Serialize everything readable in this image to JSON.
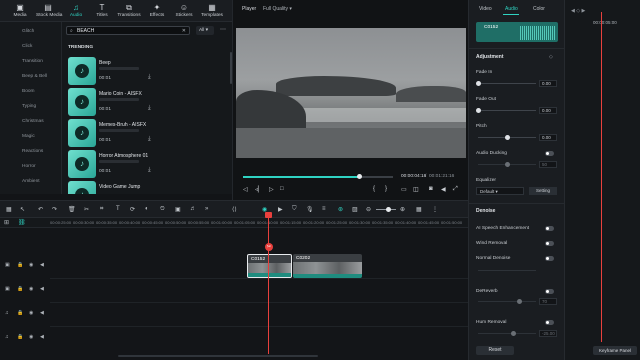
{
  "toolbar": {
    "items": [
      {
        "label": "Media",
        "icon": "media-icon"
      },
      {
        "label": "Stock Media",
        "icon": "stock-media-icon"
      },
      {
        "label": "Audio",
        "icon": "audio-icon"
      },
      {
        "label": "Titles",
        "icon": "titles-icon"
      },
      {
        "label": "Transitions",
        "icon": "transitions-icon"
      },
      {
        "label": "Effects",
        "icon": "effects-icon"
      },
      {
        "label": "Stickers",
        "icon": "stickers-icon"
      },
      {
        "label": "Templates",
        "icon": "templates-icon"
      }
    ],
    "active": "Audio"
  },
  "categories": [
    "Glitch",
    "Click",
    "Transition",
    "Beep & Bell",
    "Boom",
    "Typing",
    "Christmas",
    "Magic",
    "Reactions",
    "Horror",
    "Ambient"
  ],
  "search": {
    "value": "BEACH",
    "filter": "All"
  },
  "library": {
    "section": "TRENDING",
    "sounds": [
      {
        "title": "Beep",
        "duration": "00:01"
      },
      {
        "title": "Mario Coin - AISFX",
        "duration": "00:01"
      },
      {
        "title": "Memes-Bruh - AISFX",
        "duration": "00:01"
      },
      {
        "title": "Horror Atmosphere 01",
        "duration": "00:01"
      },
      {
        "title": "Video Game Jump",
        "duration": ""
      }
    ]
  },
  "player": {
    "label": "Player",
    "quality": "Full Quality",
    "current_time": "00:00:04:18",
    "separator": "/",
    "total_time": "00:01:21:16",
    "progress": 0.77
  },
  "properties": {
    "tabs": [
      "Video",
      "Audio",
      "Color"
    ],
    "active_tab": "Audio",
    "clip_name": "C0152",
    "adjustment": {
      "title": "Adjustment",
      "fade_in_label": "Fade In",
      "fade_in_value": "0.00",
      "fade_out_label": "Fade Out",
      "fade_out_value": "0.00",
      "pitch_label": "Pitch",
      "pitch_value": "0.00",
      "ducking_label": "Audio Ducking",
      "ducking_value": "50",
      "equalizer_label": "Equalizer",
      "equalizer_value": "Default",
      "equalizer_setting": "Setting"
    },
    "denoise": {
      "title": "Denoise",
      "ai_speech": "AI Speech Enhancement",
      "wind": "Wind Removal",
      "normal": "Normal Denoise",
      "dereverb": "DeReverb",
      "dereverb_value": "70",
      "hum": "Hum Removal",
      "hum_value": "-25.00"
    },
    "reset_label": "Reset"
  },
  "keyframe": {
    "time": "00:00:05:00",
    "button_label": "Keyframe Panel"
  },
  "ruler": {
    "ticks": [
      "00:00:25:00",
      "00:00:30:00",
      "00:00:35:00",
      "00:00:40:00",
      "00:00:45:00",
      "00:00:50:00",
      "00:00:55:00",
      "00:01:00:00",
      "00:01:05:00",
      "00:01:10:00",
      "00:01:15:00",
      "00:01:20:00",
      "00:01:25:00",
      "00:01:30:00",
      "00:01:35:00",
      "00:01:40:00",
      "00:01:45:00",
      "00:01:50:00"
    ]
  },
  "timeline": {
    "clips": [
      {
        "name": "C0152"
      },
      {
        "name": "C0202"
      }
    ]
  },
  "colors": {
    "accent": "#2fd3c2",
    "playhead": "#e8403d",
    "background": "#121417"
  }
}
